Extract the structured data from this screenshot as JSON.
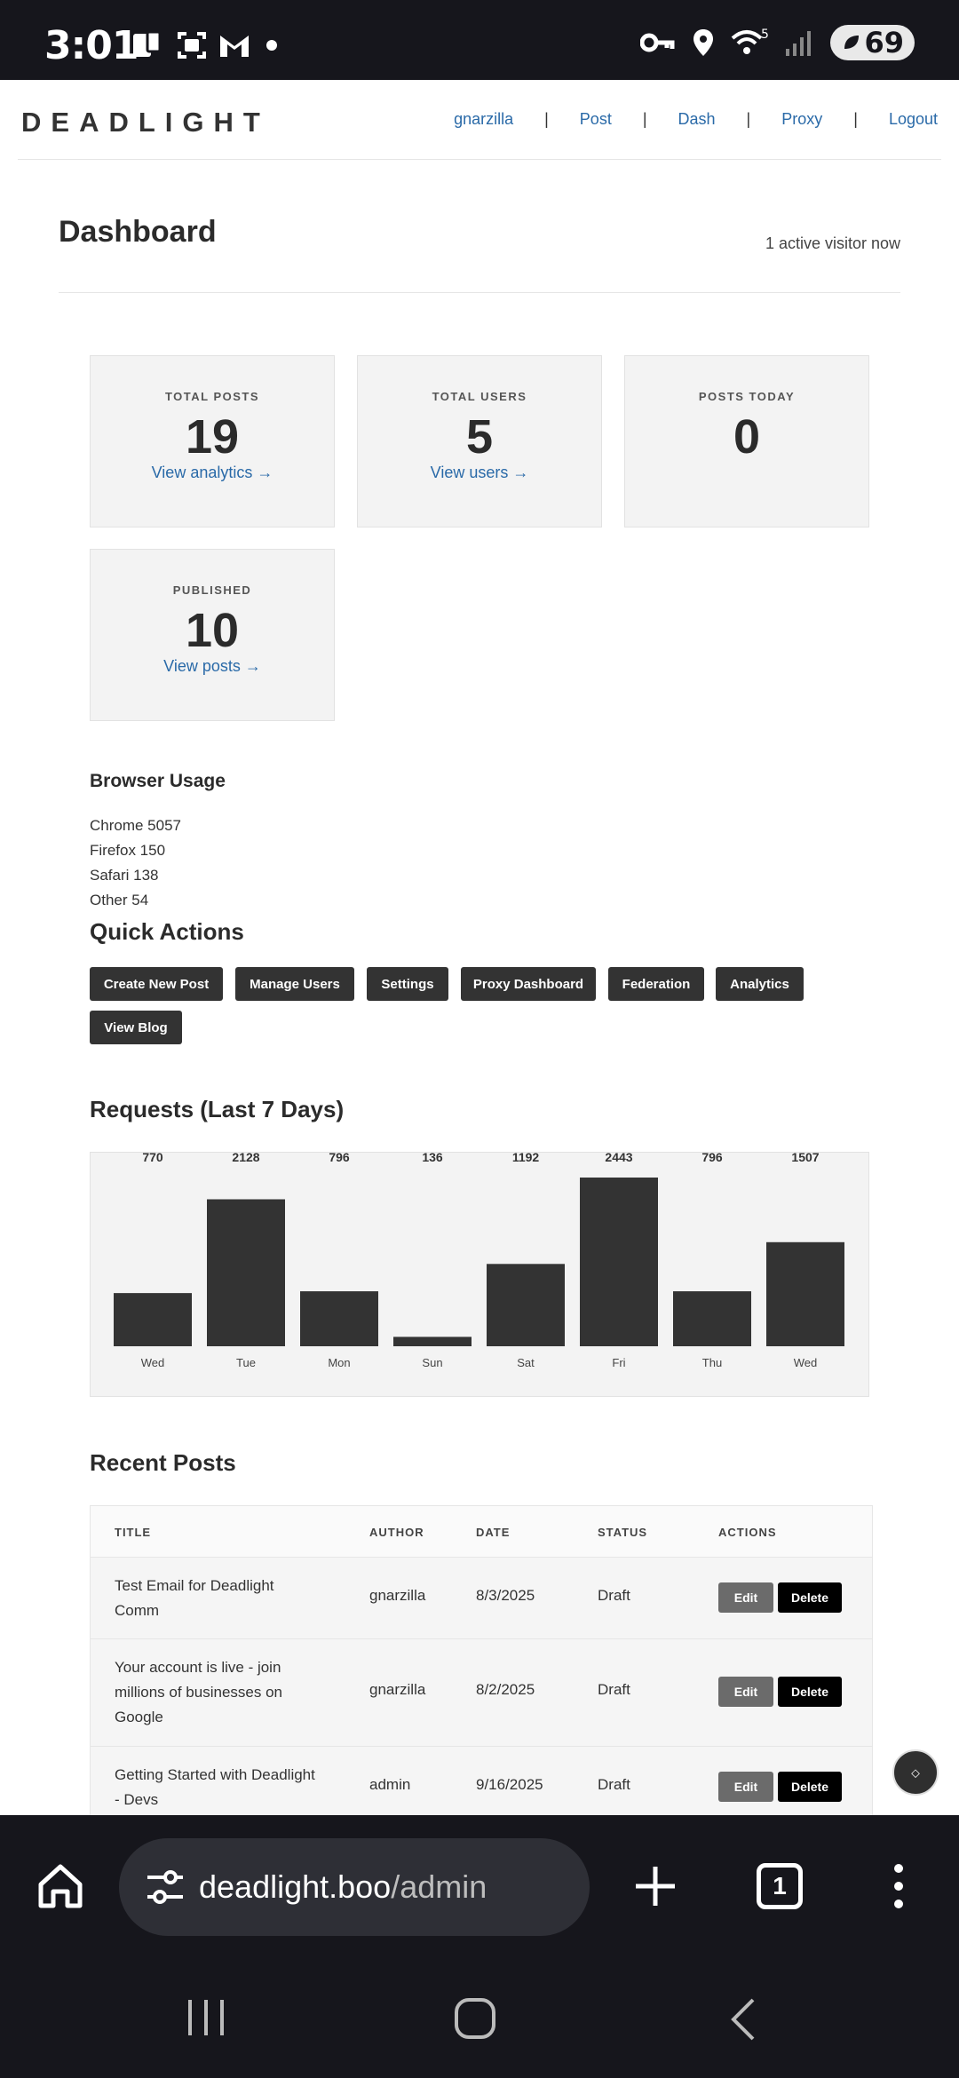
{
  "status_bar": {
    "time": "3:01",
    "battery": "69",
    "wifi_badge": "5"
  },
  "header": {
    "brand": "DEADLIGHT",
    "nav": [
      "gnarzilla",
      "Post",
      "Dash",
      "Proxy",
      "Logout"
    ],
    "separator": "|"
  },
  "dashboard": {
    "title": "Dashboard",
    "visitors": "1 active visitor now"
  },
  "stats": [
    {
      "label": "TOTAL POSTS",
      "value": "19",
      "link": "View analytics →"
    },
    {
      "label": "TOTAL USERS",
      "value": "5",
      "link": "View users →"
    },
    {
      "label": "POSTS TODAY",
      "value": "0",
      "link": ""
    },
    {
      "label": "PUBLISHED",
      "value": "10",
      "link": "View posts →"
    }
  ],
  "browser_usage": {
    "title": "Browser Usage",
    "items": [
      "Chrome 5057",
      "Firefox 150",
      "Safari 138",
      "Other 54"
    ]
  },
  "quick_actions": {
    "title": "Quick Actions",
    "buttons": [
      "Create New Post",
      "Manage Users",
      "Settings",
      "Proxy Dashboard",
      "Federation",
      "Analytics",
      "View Blog"
    ]
  },
  "chart_data": {
    "type": "bar",
    "title": "Requests (Last 7 Days)",
    "categories": [
      "Wed",
      "Tue",
      "Mon",
      "Sun",
      "Sat",
      "Fri",
      "Thu",
      "Wed"
    ],
    "values": [
      770,
      2128,
      796,
      136,
      1192,
      2443,
      796,
      1507
    ],
    "xlabel": "",
    "ylabel": "",
    "grid": false
  },
  "recent_posts": {
    "title": "Recent Posts",
    "columns": [
      "TITLE",
      "AUTHOR",
      "DATE",
      "STATUS",
      "ACTIONS"
    ],
    "rows": [
      {
        "title": "Test Email for Deadlight Comm",
        "author": "gnarzilla",
        "date": "8/3/2025",
        "status": "Draft"
      },
      {
        "title": "Your account is live - join millions of businesses on Google",
        "author": "gnarzilla",
        "date": "8/2/2025",
        "status": "Draft"
      },
      {
        "title": "Getting Started with Deadlight - Devs",
        "author": "admin",
        "date": "9/16/2025",
        "status": "Draft"
      }
    ],
    "edit_label": "Edit",
    "delete_label": "Delete"
  },
  "floating_button": {
    "glyph": "⬦"
  },
  "browser": {
    "url_domain": "deadlight.boo",
    "url_path": "/admin",
    "tab_count": "1"
  },
  "colors": {
    "link": "#2a6aa8",
    "dark_button": "#333333",
    "bar": "#333333",
    "card_bg": "#f3f3f3",
    "system_bar": "#16161c"
  }
}
